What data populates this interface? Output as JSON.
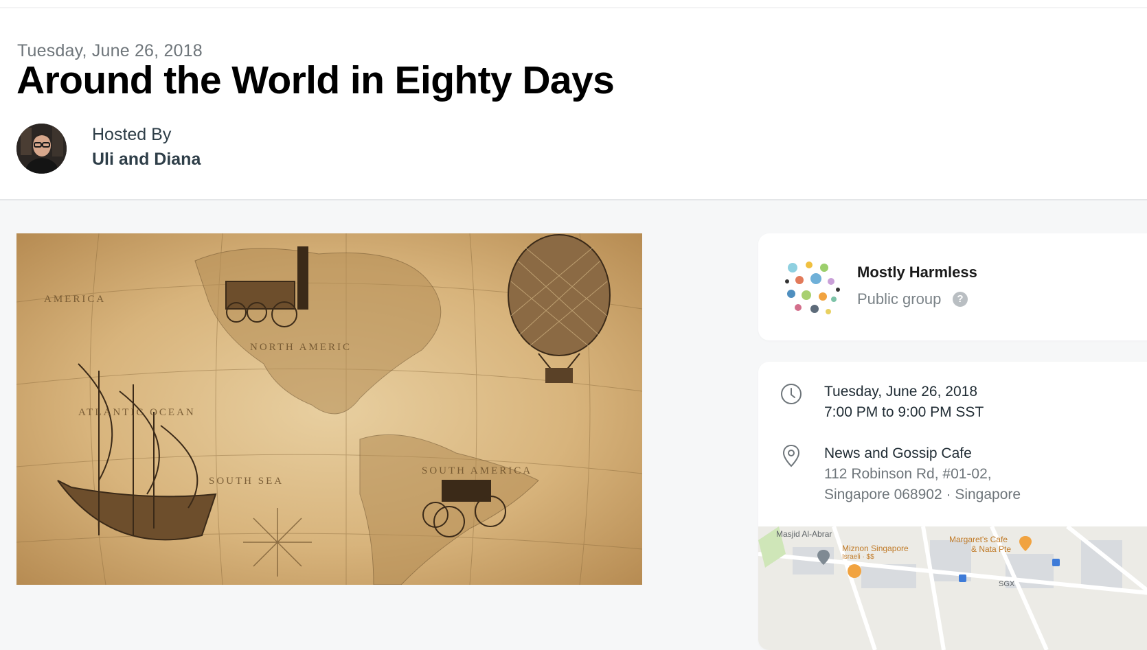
{
  "event": {
    "date": "Tuesday, June 26, 2018",
    "title": "Around the World in Eighty Days"
  },
  "host": {
    "label": "Hosted By",
    "name": "Uli and Diana"
  },
  "group": {
    "name": "Mostly Harmless",
    "type": "Public group",
    "help_glyph": "?"
  },
  "details": {
    "date": "Tuesday, June 26, 2018",
    "time": "7:00 PM to 9:00 PM SST",
    "venue_name": "News and Gossip Cafe",
    "address_line1": "112 Robinson Rd, #01-02,",
    "address_line2": "Singapore 068902 · Singapore"
  },
  "map": {
    "poi_1": "Masjid Al-Abrar",
    "poi_2": "Miznon Singapore",
    "poi_2_sub": "Israeli · $$",
    "poi_3_line1": "Margaret's Cafe",
    "poi_3_line2": "& Nata Pte",
    "poi_4": "SGX"
  },
  "icons": {
    "clock": "clock-icon",
    "location": "location-pin-icon",
    "help": "help-icon"
  },
  "colors": {
    "title": "#000000",
    "muted": "#6e757a",
    "map_accent": "#c07a27"
  }
}
